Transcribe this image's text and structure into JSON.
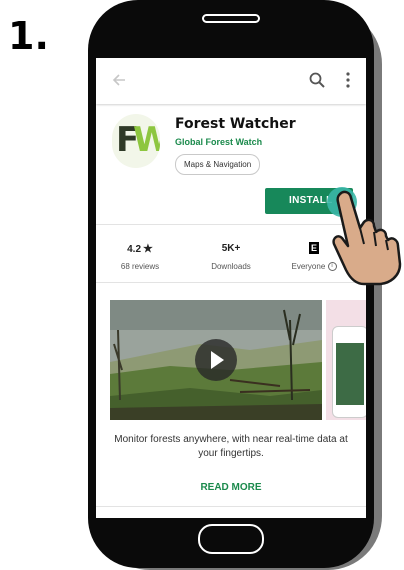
{
  "step_number": "1.",
  "toolbar": {
    "back": "back-arrow-icon",
    "search": "search-icon",
    "more": "more-vert-icon"
  },
  "app": {
    "logo_text_left": "F",
    "logo_text_right": "W",
    "title": "Forest Watcher",
    "developer": "Global Forest Watch",
    "category": "Maps & Navigation",
    "install_label": "INSTALL"
  },
  "stats": {
    "rating_value": "4.2",
    "rating_label": "68 reviews",
    "downloads_value": "5K+",
    "downloads_label": "Downloads",
    "content_rating_icon": "E",
    "content_rating_label": "Everyone"
  },
  "description": "Monitor forests anywhere, with near real-time data at your fingertips.",
  "read_more": "READ MORE",
  "colors": {
    "accent": "#17885a",
    "developer_text": "#1b8a4c",
    "logo_green": "#8dc63f",
    "pointer_circle": "#3ab6a6",
    "hand_skin": "#d9ab8a"
  }
}
